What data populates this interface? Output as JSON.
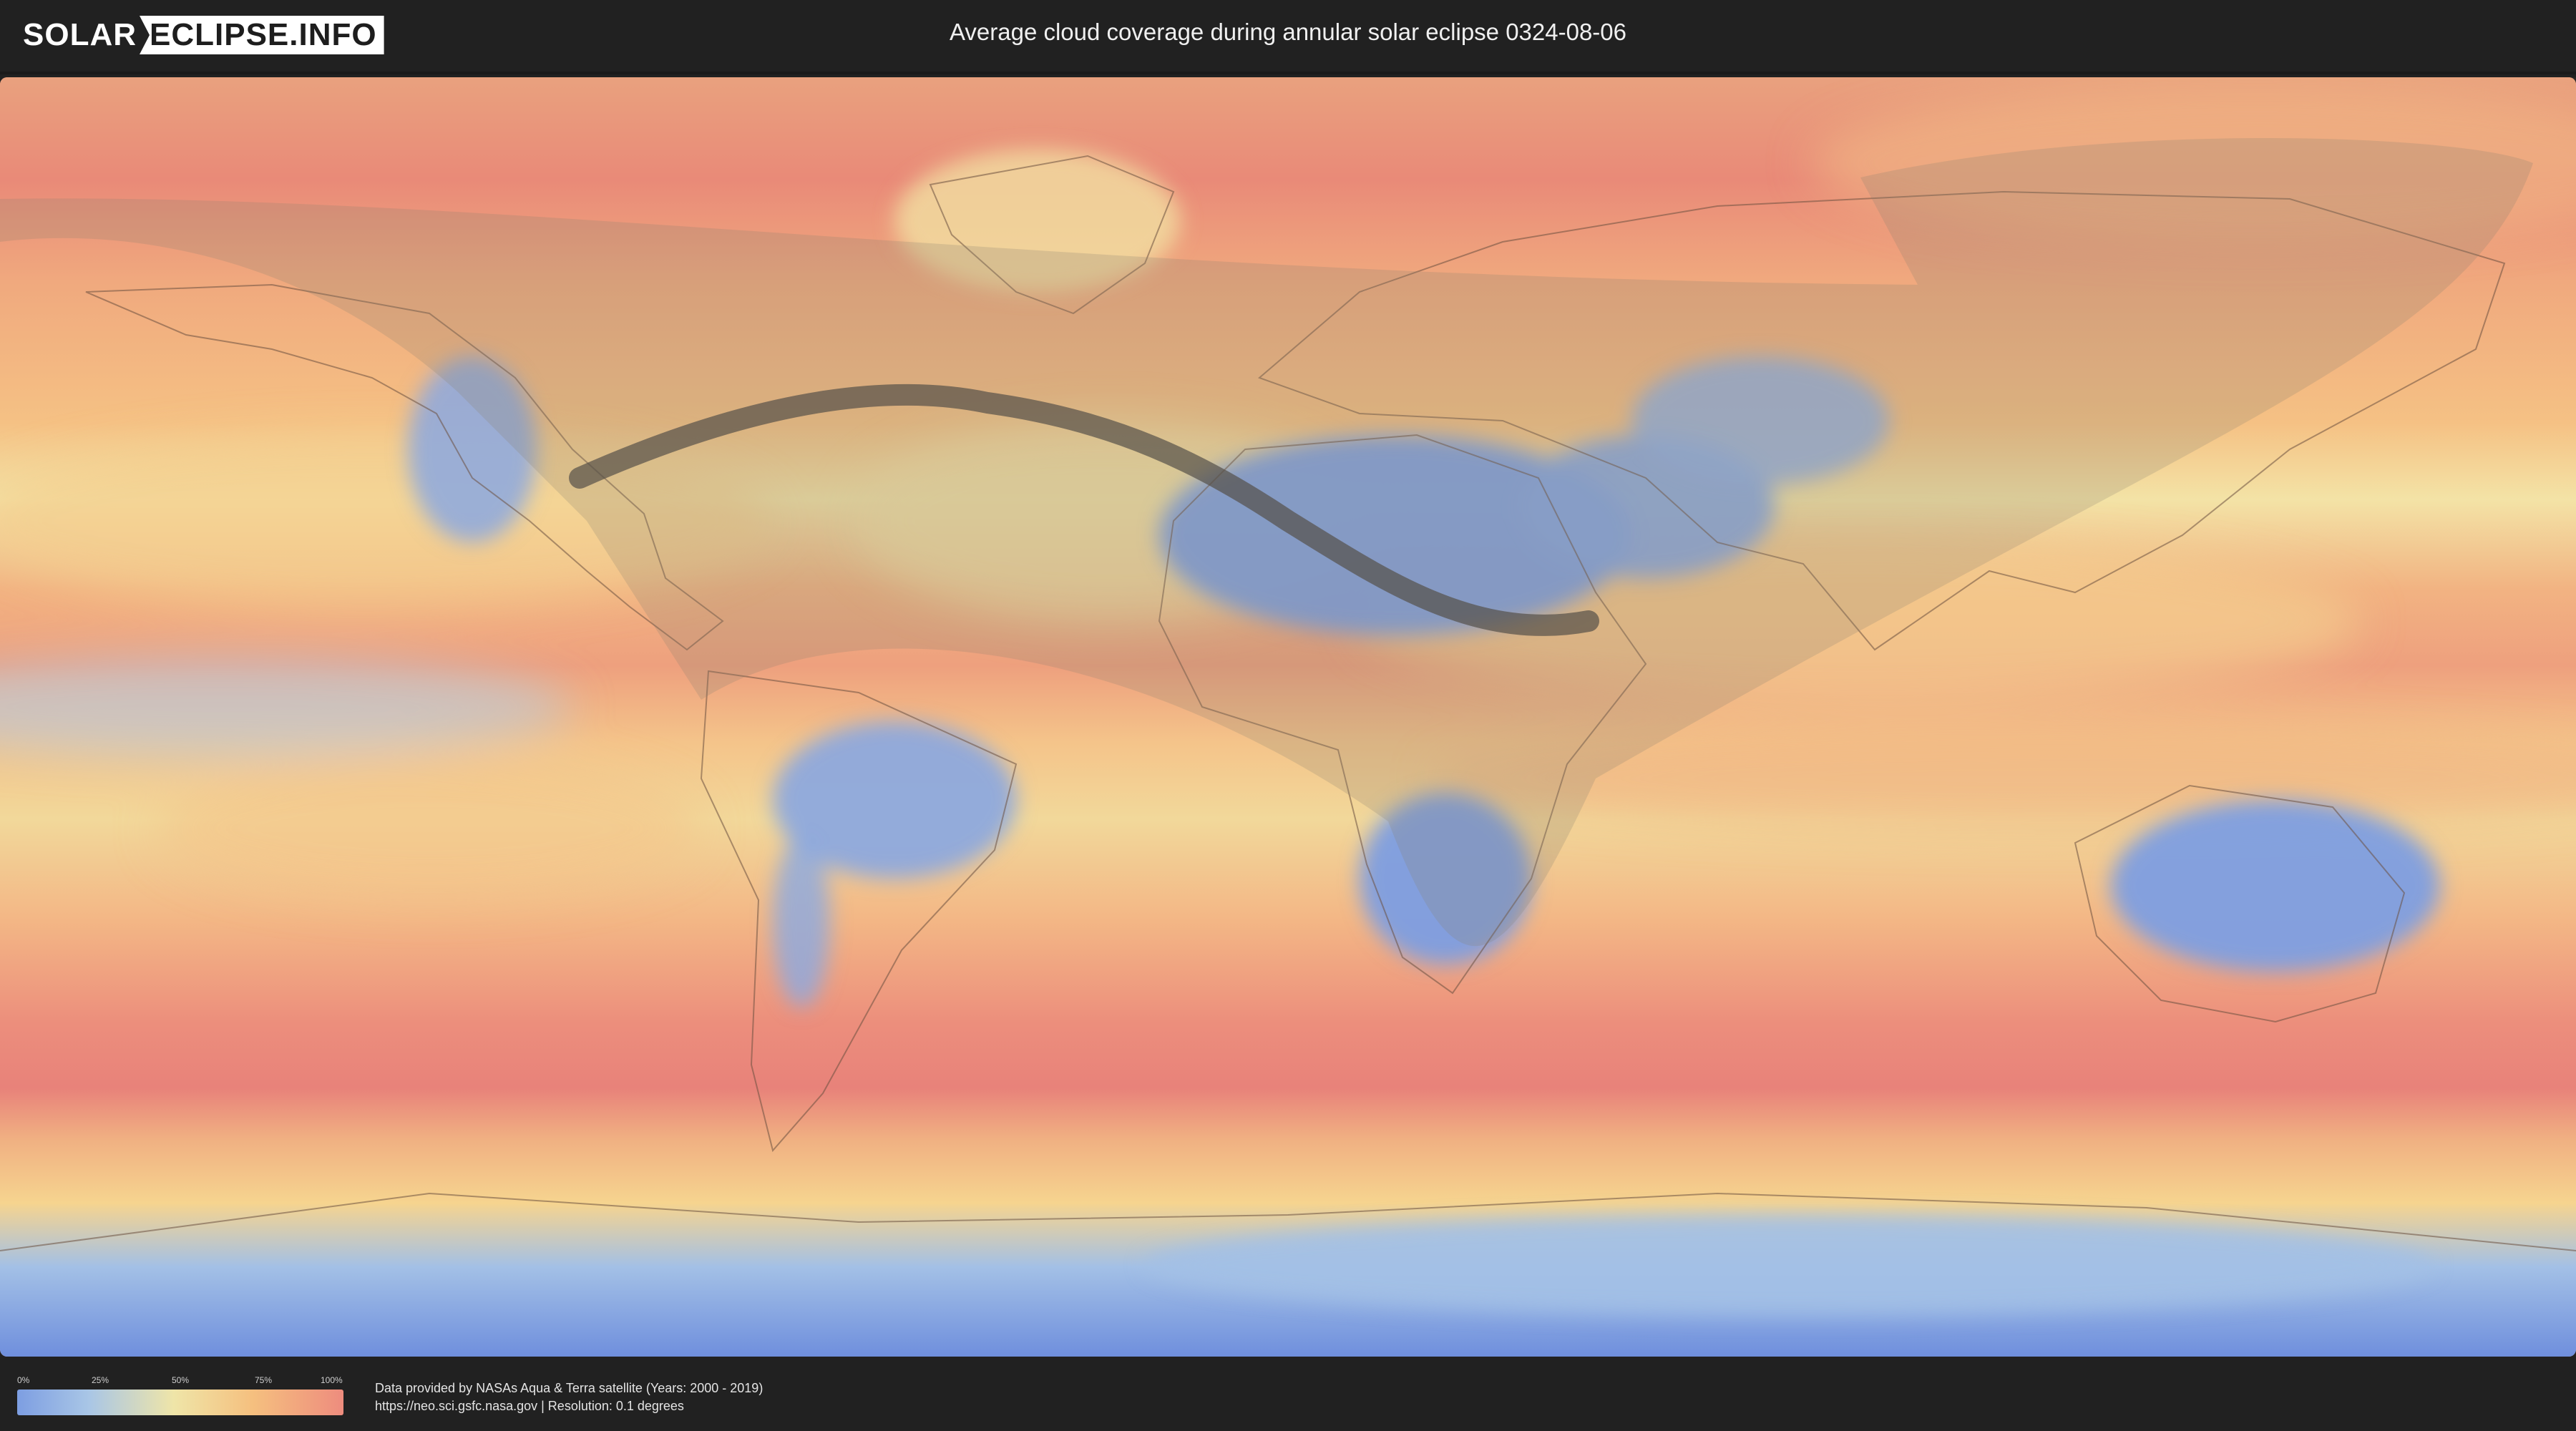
{
  "header": {
    "logo_left": "SOLAR",
    "logo_right": "ECLIPSE.INFO",
    "title": "Average cloud coverage during annular solar eclipse 0324-08-06"
  },
  "legend": {
    "ticks": [
      "0%",
      "25%",
      "50%",
      "75%",
      "100%"
    ],
    "colors": [
      "#7d9ee2",
      "#a9c6e6",
      "#efe5a8",
      "#f5c07f",
      "#ee8c7e"
    ]
  },
  "credits": {
    "line1": "Data provided by NASAs Aqua & Terra satellite (Years: 2000 - 2019)",
    "line2": "https://neo.sci.gsfc.nasa.gov | Resolution: 0.1 degrees"
  },
  "map": {
    "projection": "equirectangular",
    "colors": {
      "clear": "#7d9ee2",
      "partly": "#efe5a8",
      "cloudy": "#ee8c7e",
      "path": "#555048"
    }
  }
}
